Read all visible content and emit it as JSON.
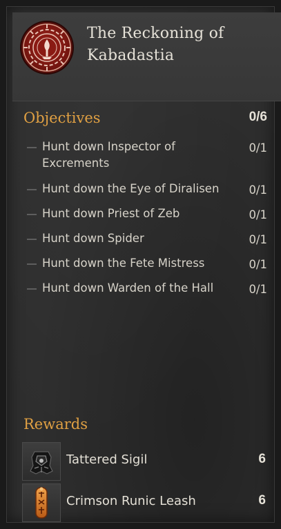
{
  "quest": {
    "title": "The Reckoning of\nKabadastia",
    "emblem_icon": "red-sun-seal-icon"
  },
  "objectives": {
    "heading": "Objectives",
    "total": "0/6",
    "items": [
      {
        "text": "Hunt down Inspector  of\nExcrements",
        "count": "0/1"
      },
      {
        "text": "Hunt down the Eye  of Diralisen",
        "count": "0/1"
      },
      {
        "text": "Hunt down Priest of  Zeb",
        "count": "0/1"
      },
      {
        "text": "Hunt down Spider",
        "count": "0/1"
      },
      {
        "text": "Hunt down the Fete  Mistress",
        "count": "0/1"
      },
      {
        "text": "Hunt down Warden of  the Hall",
        "count": "0/1"
      }
    ]
  },
  "rewards": {
    "heading": "Rewards",
    "items": [
      {
        "name": "Tattered Sigil",
        "qty": "6",
        "icon": "tattered-sigil-icon"
      },
      {
        "name": "Crimson Runic Leash",
        "qty": "6",
        "icon": "runic-leash-icon"
      }
    ]
  },
  "colors": {
    "heading_accent": "#e0a043",
    "text": "#d8d4ca",
    "panel": "#2e2e2e"
  }
}
